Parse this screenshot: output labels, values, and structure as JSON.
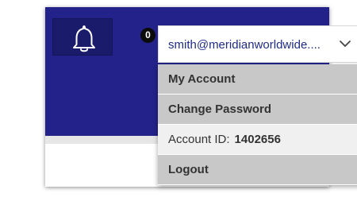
{
  "notifications": {
    "icon": "bell-icon",
    "count": "0"
  },
  "user_menu": {
    "email": "smith@meridianworldwide....",
    "toggle_icon": "chevron-down-icon",
    "items": [
      {
        "label": "My Account"
      },
      {
        "label": "Change Password"
      }
    ],
    "account_id_label": "Account ID:",
    "account_id_value": "1402656",
    "logout_label": "Logout"
  },
  "colors": {
    "header_bg": "#22228a",
    "bell_bg": "#1b1b6c",
    "email_text": "#1f2c8a",
    "menu_button_bg": "#c8c8c8",
    "menu_info_bg": "#f0f0f0"
  }
}
